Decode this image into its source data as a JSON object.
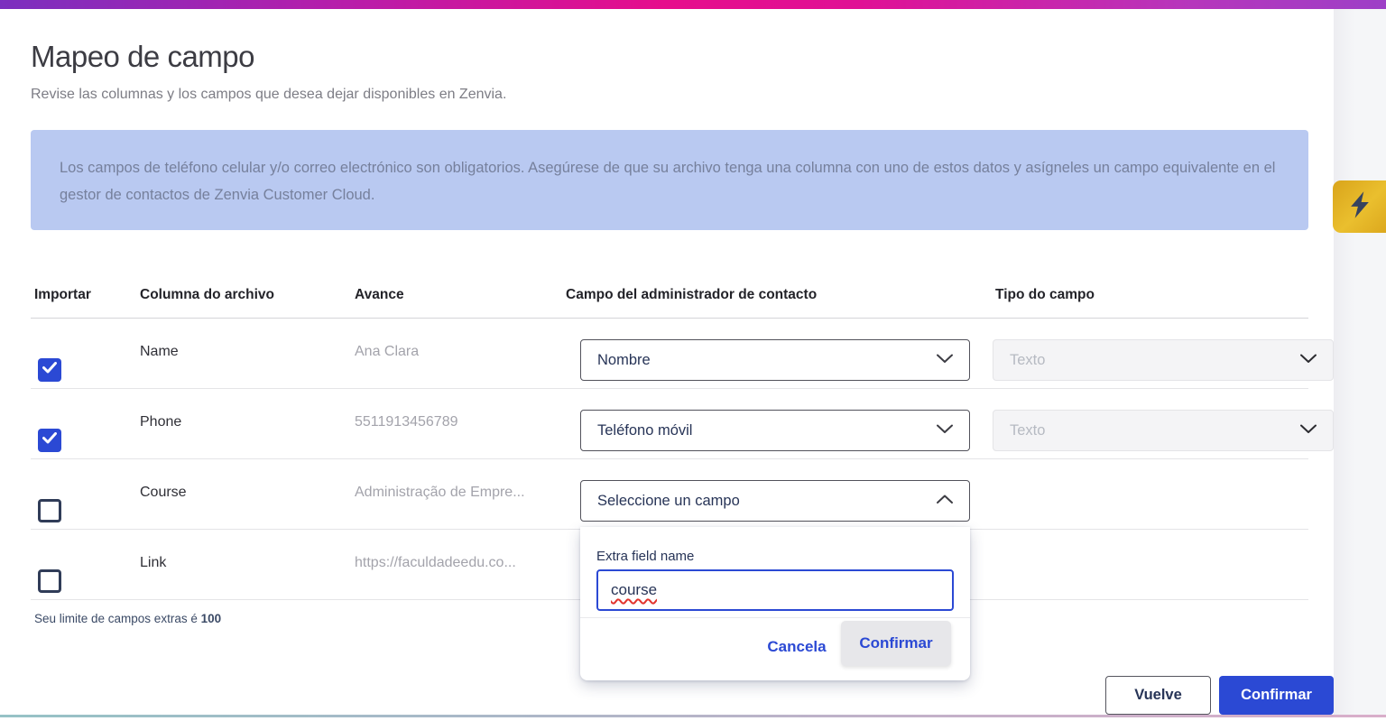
{
  "page": {
    "title": "Mapeo de campo",
    "subtitle": "Revise las columnas y los campos que desea dejar disponibles en Zenvia.",
    "info_banner": "Los campos de teléfono celular y/o correo electrónico son obligatorios. Asegúrese de que su archivo tenga una columna con uno de estos datos y asígneles un campo equivalente en el gestor de contactos de Zenvia Customer Cloud."
  },
  "table": {
    "headers": [
      "Importar",
      "Columna do archivo",
      "Avance",
      "Campo del administrador de contacto",
      "Tipo do campo"
    ],
    "rows": [
      {
        "checked": true,
        "column": "Name",
        "preview": "Ana Clara",
        "field": "Nombre",
        "type": "Texto"
      },
      {
        "checked": true,
        "column": "Phone",
        "preview": "5511913456789",
        "field": "Teléfono móvil",
        "type": "Texto"
      },
      {
        "checked": false,
        "column": "Course",
        "preview": "Administração de Empre...",
        "field": "Seleccione un campo",
        "type": ""
      },
      {
        "checked": false,
        "column": "Link",
        "preview": "https://faculdadeedu.co...",
        "field": "",
        "type": ""
      }
    ]
  },
  "limit_note": {
    "prefix": "Seu limite de campos extras é ",
    "value": "100"
  },
  "popup": {
    "label": "Extra field name",
    "input_value": "course",
    "cancel_label": "Cancela",
    "confirm_label": "Confirmar"
  },
  "footer": {
    "back_label": "Vuelve",
    "confirm_label": "Confirmar"
  },
  "icons": {
    "lightning": "lightning-bolt-icon",
    "chevron_down": "chevron-down-icon",
    "chevron_up": "chevron-up-icon",
    "checkmark": "checkmark-icon"
  },
  "colors": {
    "primary_blue": "#2b49d4",
    "navy_text": "#273457",
    "banner_bg": "#b9c9f1",
    "banner_text": "#76809c",
    "accent_yellow": "#e3ac20",
    "topbar_gradient": [
      "#7b2fbf",
      "#e60d8c",
      "#9d3fc7"
    ],
    "disabled_bg": "#f4f4f6",
    "spellcheck_red": "#e2342e"
  }
}
